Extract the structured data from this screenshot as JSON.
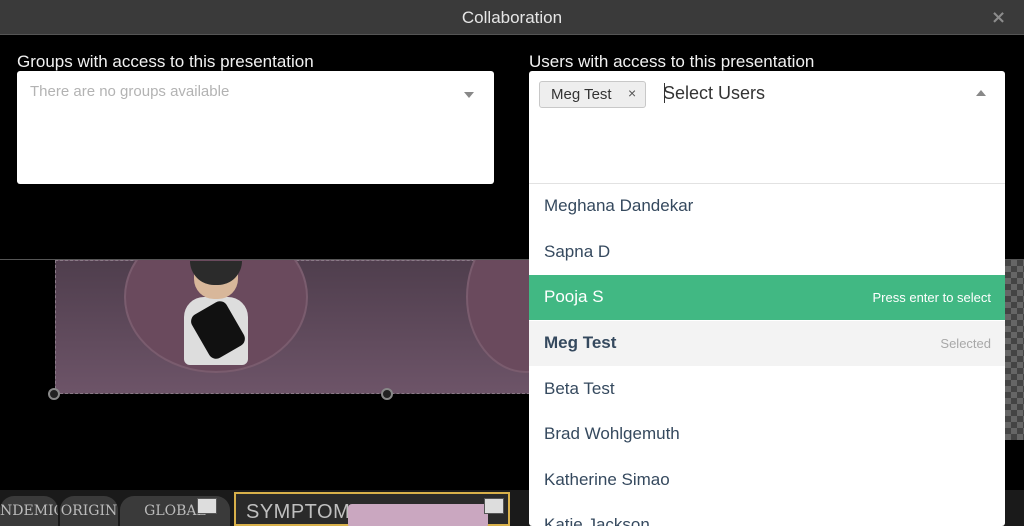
{
  "modal": {
    "title": "Collaboration",
    "close_glyph": "×"
  },
  "groups": {
    "label": "Groups with access to this presentation",
    "placeholder": "There are no groups available"
  },
  "users": {
    "label": "Users with access to this presentation",
    "selected_tags": [
      {
        "label": "Meg Test",
        "remove_glyph": "×"
      }
    ],
    "input_placeholder": "Select Users",
    "options": [
      {
        "name": "Meghana Dandekar",
        "hint": ""
      },
      {
        "name": "Sapna D",
        "hint": ""
      },
      {
        "name": "Pooja S",
        "hint": "Press enter to select",
        "state": "highlighted"
      },
      {
        "name": "Meg Test",
        "hint": "Selected",
        "state": "selected"
      },
      {
        "name": "Beta Test",
        "hint": ""
      },
      {
        "name": "Brad Wohlgemuth",
        "hint": ""
      },
      {
        "name": "Katherine Simao",
        "hint": ""
      },
      {
        "name": "Katie Jackson",
        "hint": ""
      }
    ]
  },
  "background": {
    "thumbnails": [
      "NDEMIC",
      "ORIGIN",
      "GLOBAL"
    ],
    "active_thumbnail": "SYMPTOMS"
  },
  "colors": {
    "highlight": "#41b883",
    "header_bg": "#3a3a3a",
    "option_text": "#35495e"
  }
}
